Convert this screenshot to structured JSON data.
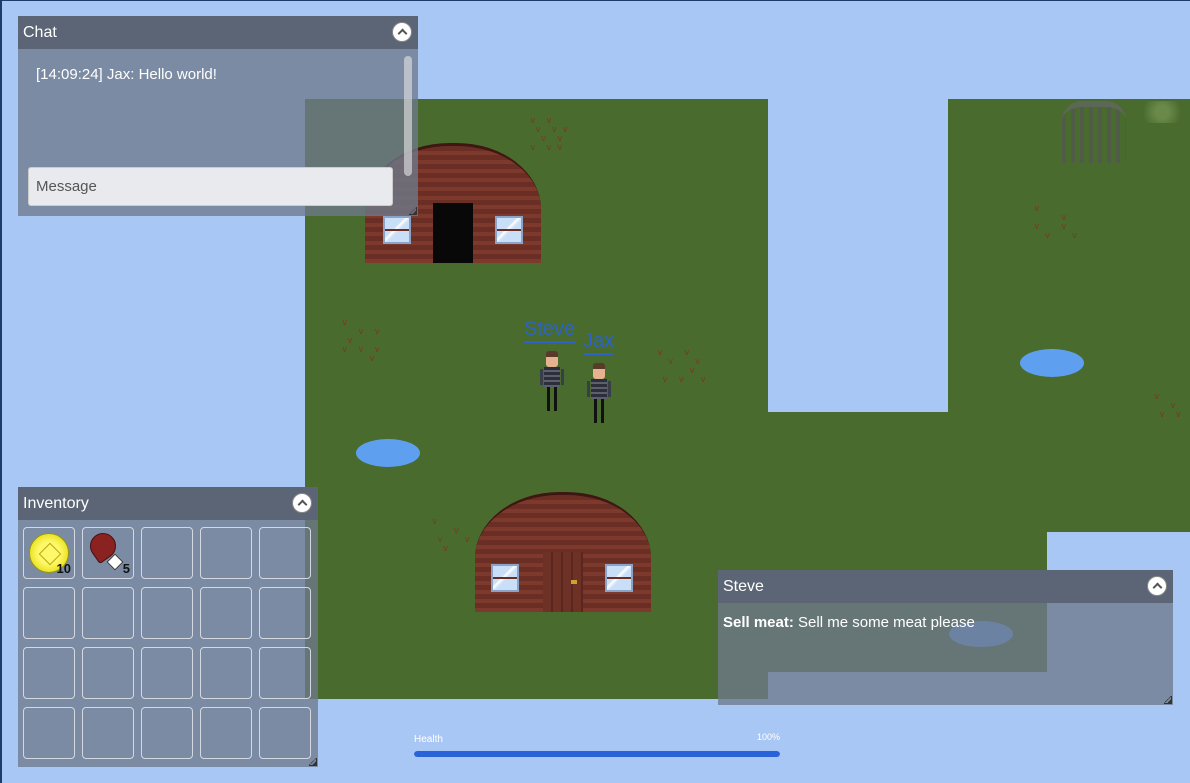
{
  "chat": {
    "title": "Chat",
    "messages": [
      "[14:09:24] Jax: Hello world!"
    ],
    "input_placeholder": "Message"
  },
  "players": {
    "steve": "Steve",
    "jax": "Jax"
  },
  "inventory": {
    "title": "Inventory",
    "slots": [
      {
        "item": "coin-icon",
        "count": "10"
      },
      {
        "item": "meat-icon",
        "count": "5"
      }
    ]
  },
  "npc_dialog": {
    "title": "Steve",
    "option_label": "Sell meat:",
    "option_text": "Sell me some meat please"
  },
  "health": {
    "label": "Health",
    "percent_text": "100%",
    "value": 1.0
  },
  "colors": {
    "sky": "#a9c7f5",
    "grass": "#4a6b2e",
    "water": "#5f9ff0",
    "health_bar": "#2a62d9",
    "nametag": "#2b63c9"
  }
}
